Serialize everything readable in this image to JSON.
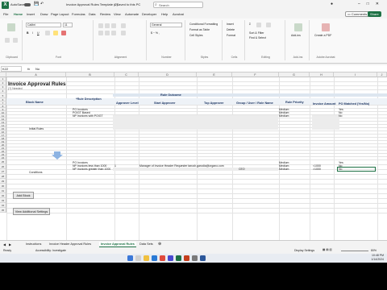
{
  "titlebar": {
    "autosave": "AutoSave",
    "filename": "Invoice Approval Rules Template (2)",
    "status": "• Saved to this PC",
    "search": "Search"
  },
  "menu": [
    "File",
    "Home",
    "Insert",
    "Draw",
    "Page Layout",
    "Formulas",
    "Data",
    "Review",
    "View",
    "Automate",
    "Developer",
    "Help",
    "Acrobat"
  ],
  "menu_active": "Home",
  "comments": "Comments",
  "share": "Share",
  "ribbon": {
    "font_name": "Calibri",
    "font_size": "11",
    "groups": [
      "Clipboard",
      "Font",
      "Alignment",
      "Number",
      "Styles",
      "Cells",
      "Editing",
      "Add-ins",
      "Adobe Acrobat"
    ],
    "number_format": "General",
    "styles": [
      "Conditional Formatting",
      "Format as Table",
      "Cell Styles"
    ],
    "cells": [
      "Insert",
      "Delete",
      "Format"
    ],
    "editing": [
      "Sort & Filter",
      "Find & Select"
    ],
    "addins": "Add-ins",
    "acrobat": "Create a PDF"
  },
  "formula": {
    "namebox": "K22",
    "fx": "fx",
    "value": "No"
  },
  "columns": [
    "A",
    "B",
    "C",
    "D",
    "E",
    "F",
    "G",
    "H",
    "I",
    "J"
  ],
  "rows": [
    "1",
    "2",
    "3",
    "4",
    "5",
    "6",
    "7",
    "8",
    "9",
    "10",
    "11",
    "12",
    "13",
    "14",
    "15",
    "16",
    "17",
    "18",
    "19",
    "20",
    "21",
    "22",
    "23",
    "24",
    "25",
    "26",
    "27",
    "28",
    "29",
    "30",
    "31",
    "32",
    "33",
    "34",
    "35"
  ],
  "sheet": {
    "title": "Invoice Approval Rules",
    "subtitle": "(?) Needed",
    "rule_outcome": "Rule Outcome",
    "invoice_label": "Invoice A",
    "headers": {
      "block": "Block Name",
      "desc": "*Rule Description",
      "approver_level": "Approver Level",
      "start_approver": "Start Approver",
      "top_approver": "Top Approver",
      "group": "Group / User / Role Name",
      "priority": "Rule Priority",
      "amount": "Invoice Amount",
      "po_matched": "PO Matched (Yes/No)"
    },
    "block1": {
      "name": "Initial Rules",
      "rules": [
        {
          "desc": "PO Invoices",
          "priority": "Medium",
          "po": "Yes"
        },
        {
          "desc": "PO/GT Based",
          "priority": "Medium",
          "po": "No"
        },
        {
          "desc": "NP Invoices with PO/GT",
          "priority": "Medium",
          "po": "No"
        }
      ]
    },
    "block2": {
      "name": "Conditions",
      "rules": [
        {
          "desc": "PO Invoices",
          "level": "",
          "start": "",
          "group": "",
          "priority": "Medium",
          "amount": "",
          "po": "Yes"
        },
        {
          "desc": "NP Invoices less than 1000",
          "level": "1",
          "start": "Manager of Invoice Header Requester  tarush.garodia@organo.com",
          "group": "",
          "priority": "Medium",
          "amount": "<1000",
          "po": "No"
        },
        {
          "desc": "NP Invoices greater than 1000",
          "level": "",
          "start": "",
          "group": "CEO",
          "priority": "Medium",
          "amount": ">1000",
          "po": "No"
        }
      ]
    },
    "buttons": {
      "add_block": "Add Block",
      "view_settings": "View Additional Settings"
    }
  },
  "tabs": [
    "Instructions",
    "Invoice Header Approval Rules",
    "Invoice Approval Rules",
    "Data Sets"
  ],
  "tab_active": "Invoice Approval Rules",
  "status": {
    "ready": "Ready",
    "accessibility": "Accessibility: Investigate",
    "display": "Display Settings",
    "zoom": "80%"
  },
  "clock": {
    "time": "10:48 PM",
    "date": "1/14/2024"
  },
  "colors": {
    "excel_green": "#1e7145",
    "header_band": "#dde6f0"
  }
}
